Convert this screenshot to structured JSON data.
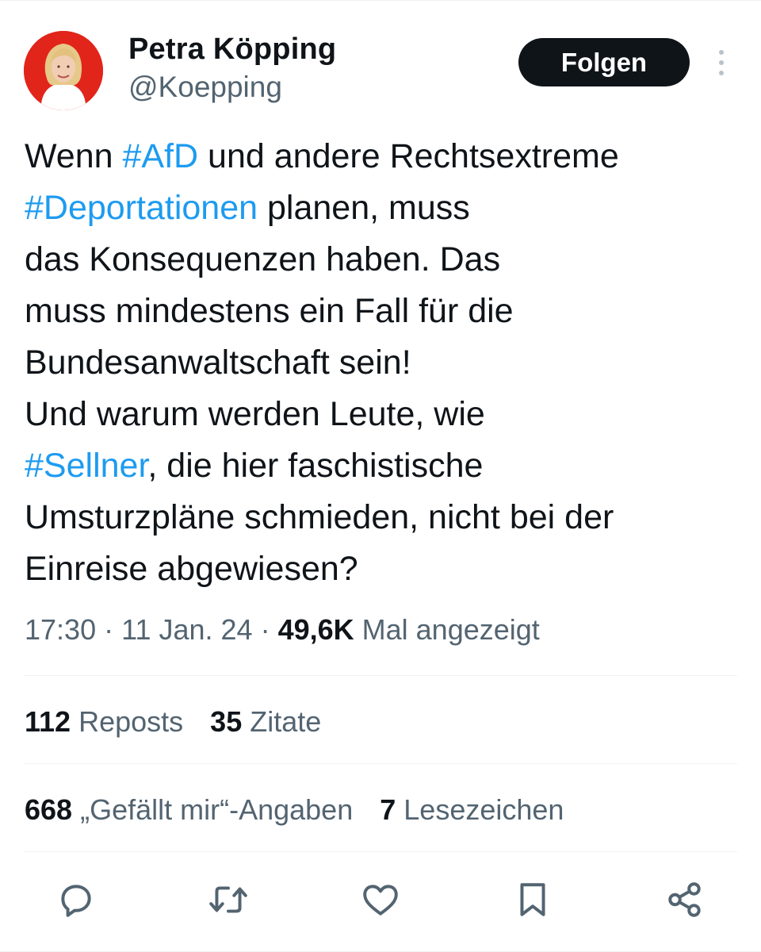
{
  "author": {
    "name": "Petra Köpping",
    "handle": "@Koepping"
  },
  "follow_button": {
    "label": "Folgen"
  },
  "tweet": {
    "lines": [
      [
        {
          "t": "Wenn ",
          "tag": false
        },
        {
          "t": "#AfD",
          "tag": true
        },
        {
          "t": " und andere Rechtsextreme",
          "tag": false
        }
      ],
      [
        {
          "t": "#Deportationen",
          "tag": true
        },
        {
          "t": " planen, muss",
          "tag": false
        }
      ],
      [
        {
          "t": "das Konsequenzen haben. Das",
          "tag": false
        }
      ],
      [
        {
          "t": "muss mindestens ein Fall für die",
          "tag": false
        }
      ],
      [
        {
          "t": "Bundesanwaltschaft sein!",
          "tag": false
        }
      ],
      [
        {
          "t": "Und warum werden Leute, wie",
          "tag": false
        }
      ],
      [
        {
          "t": "#Sellner",
          "tag": true
        },
        {
          "t": ", die hier faschistische",
          "tag": false
        }
      ],
      [
        {
          "t": "Umsturzpläne schmieden, nicht bei der",
          "tag": false
        }
      ],
      [
        {
          "t": "Einreise abgewiesen?",
          "tag": false
        }
      ]
    ]
  },
  "meta": {
    "time": "17:30",
    "sep1": " · ",
    "date": "11 Jan. 24",
    "sep2": " · ",
    "views": "49,6K",
    "views_label": " Mal angezeigt"
  },
  "stats_row1": {
    "reposts_count": "112",
    "reposts_label": "Reposts",
    "quotes_count": "35",
    "quotes_label": "Zitate"
  },
  "stats_row2": {
    "likes_count": "668",
    "likes_label": "„Gefällt mir“-Angaben",
    "bookmarks_count": "7",
    "bookmarks_label": "Lesezeichen"
  },
  "colors": {
    "hashtag": "#1d9bf0",
    "secondary_text": "#536471",
    "primary_text": "#0f1419",
    "avatar_bg": "#e1251b"
  },
  "icons": [
    "reply-icon",
    "repost-icon",
    "like-icon",
    "bookmark-icon",
    "share-icon"
  ]
}
